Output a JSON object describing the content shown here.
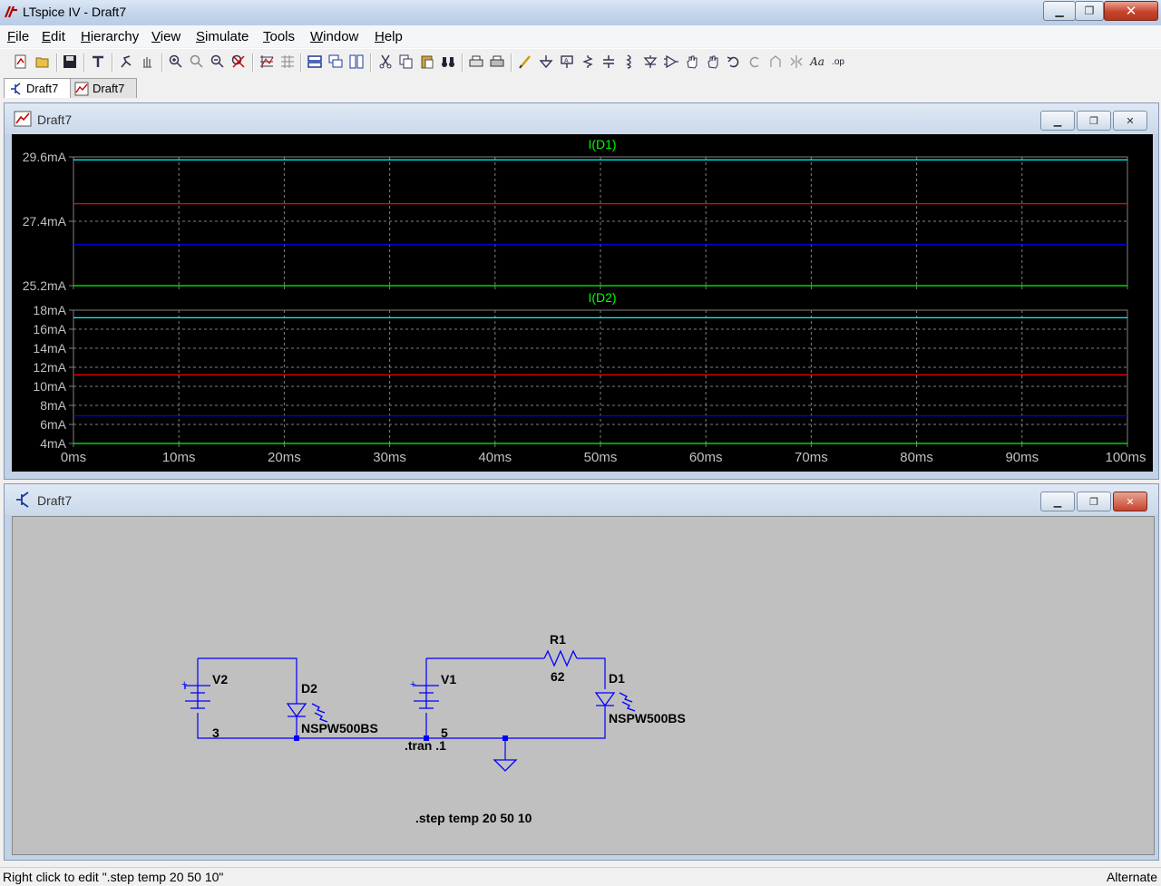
{
  "app": {
    "title": "LTspice IV - Draft7"
  },
  "menu": {
    "items": [
      {
        "label": "File",
        "accel": "F",
        "rest": "ile"
      },
      {
        "label": "Edit",
        "accel": "E",
        "rest": "dit"
      },
      {
        "label": "Hierarchy",
        "accel": "H",
        "rest": "ierarchy"
      },
      {
        "label": "View",
        "accel": "V",
        "rest": "iew"
      },
      {
        "label": "Simulate",
        "accel": "S",
        "rest": "imulate"
      },
      {
        "label": "Tools",
        "accel": "T",
        "rest": "ools"
      },
      {
        "label": "Window",
        "accel": "W",
        "rest": "indow"
      },
      {
        "label": "Help",
        "accel": "H",
        "rest": "elp"
      }
    ]
  },
  "tabs": [
    {
      "label": "Draft7",
      "icon": "schematic-icon",
      "active": true
    },
    {
      "label": "Draft7",
      "icon": "waveform-icon",
      "active": false
    }
  ],
  "plot_window": {
    "title": "Draft7",
    "bg_color": "#000000",
    "grid_color": "#808080",
    "trace_colors": [
      "#00ff00",
      "#0000ff",
      "#ff0000",
      "#00ffff"
    ]
  },
  "schematic_window": {
    "title": "Draft7",
    "wire_color": "#0000ff",
    "labels": {
      "v2": "V2",
      "v2_value": "3",
      "d2": "D2",
      "d2_model": "NSPW500BS",
      "v1": "V1",
      "v1_value": "5",
      "r1": "R1",
      "r1_value": "62",
      "d1": "D1",
      "d1_model": "NSPW500BS",
      "tran": ".tran .1",
      "step": ".step temp 20 50 10"
    }
  },
  "chart_data": [
    {
      "type": "line",
      "title": "I(D1)",
      "xlabel": "",
      "ylabel": "",
      "x_ticks": [
        "0ms",
        "10ms",
        "20ms",
        "30ms",
        "40ms",
        "50ms",
        "60ms",
        "70ms",
        "80ms",
        "90ms",
        "100ms"
      ],
      "xlim": [
        0,
        100
      ],
      "y_ticks": [
        "29.6mA",
        "27.4mA",
        "25.2mA"
      ],
      "ylim": [
        25.2,
        29.6
      ],
      "grid": true,
      "series": [
        {
          "x": [
            0,
            100
          ],
          "values": [
            25.2,
            25.2
          ],
          "color": "#00ff00"
        },
        {
          "x": [
            0,
            100
          ],
          "values": [
            26.6,
            26.6
          ],
          "color": "#0000ff"
        },
        {
          "x": [
            0,
            100
          ],
          "values": [
            28.0,
            28.0
          ],
          "color": "#ff0000"
        },
        {
          "x": [
            0,
            100
          ],
          "values": [
            29.5,
            29.5
          ],
          "color": "#00ffff"
        }
      ]
    },
    {
      "type": "line",
      "title": "I(D2)",
      "xlabel": "",
      "ylabel": "",
      "x_ticks": [
        "0ms",
        "10ms",
        "20ms",
        "30ms",
        "40ms",
        "50ms",
        "60ms",
        "70ms",
        "80ms",
        "90ms",
        "100ms"
      ],
      "xlim": [
        0,
        100
      ],
      "y_ticks": [
        "18mA",
        "16mA",
        "14mA",
        "12mA",
        "10mA",
        "8mA",
        "6mA",
        "4mA"
      ],
      "ylim": [
        4,
        18
      ],
      "grid": true,
      "series": [
        {
          "x": [
            0,
            100
          ],
          "values": [
            4.0,
            4.0
          ],
          "color": "#00ff00"
        },
        {
          "x": [
            0,
            100
          ],
          "values": [
            6.9,
            6.9
          ],
          "color": "#0000ff"
        },
        {
          "x": [
            0,
            100
          ],
          "values": [
            11.2,
            11.2
          ],
          "color": "#ff0000"
        },
        {
          "x": [
            0,
            100
          ],
          "values": [
            17.2,
            17.2
          ],
          "color": "#00ffff"
        }
      ]
    }
  ],
  "status": {
    "message": "Right click to edit \".step temp 20 50 10\"",
    "mode": "Alternate"
  }
}
